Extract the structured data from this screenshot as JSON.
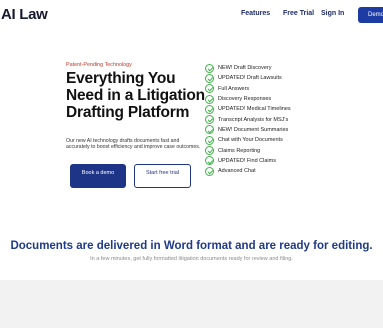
{
  "header": {
    "logo": "AI Law",
    "nav": [
      "Features",
      "Free Trial",
      "Sign In"
    ],
    "demo_button": "Demo"
  },
  "hero": {
    "eyebrow": "Patent-Pending Technology",
    "headline": "Everything You Need in a Litigation Drafting Platform",
    "subcopy": "Our new AI technology drafts documents fast and accurately to boost efficiency and improve case outcomes.",
    "primary_button": "Book a demo",
    "secondary_button": "Start free trial"
  },
  "features": [
    "NEW! Draft Discovery",
    "UPDATED! Draft Lawsuits",
    "Full Answers",
    "Discovery Responses",
    "UPDATED! Medical Timelines",
    "Transcript Analysis for MSJ's",
    "NEW! Document Summaries",
    "Chat with Your Documents",
    "Claims Reporting",
    "UPDATED! Find Claims",
    "Advanced Chat"
  ],
  "section": {
    "title": "Documents are delivered in Word format and are ready for editing.",
    "subtitle": "In a few minutes, get fully formatted litigation documents ready for review and filing."
  },
  "colors": {
    "brand": "#1e3587",
    "accent_red": "#c0392b",
    "check_green": "#3fb24a",
    "title_blue": "#1f3a8a"
  }
}
